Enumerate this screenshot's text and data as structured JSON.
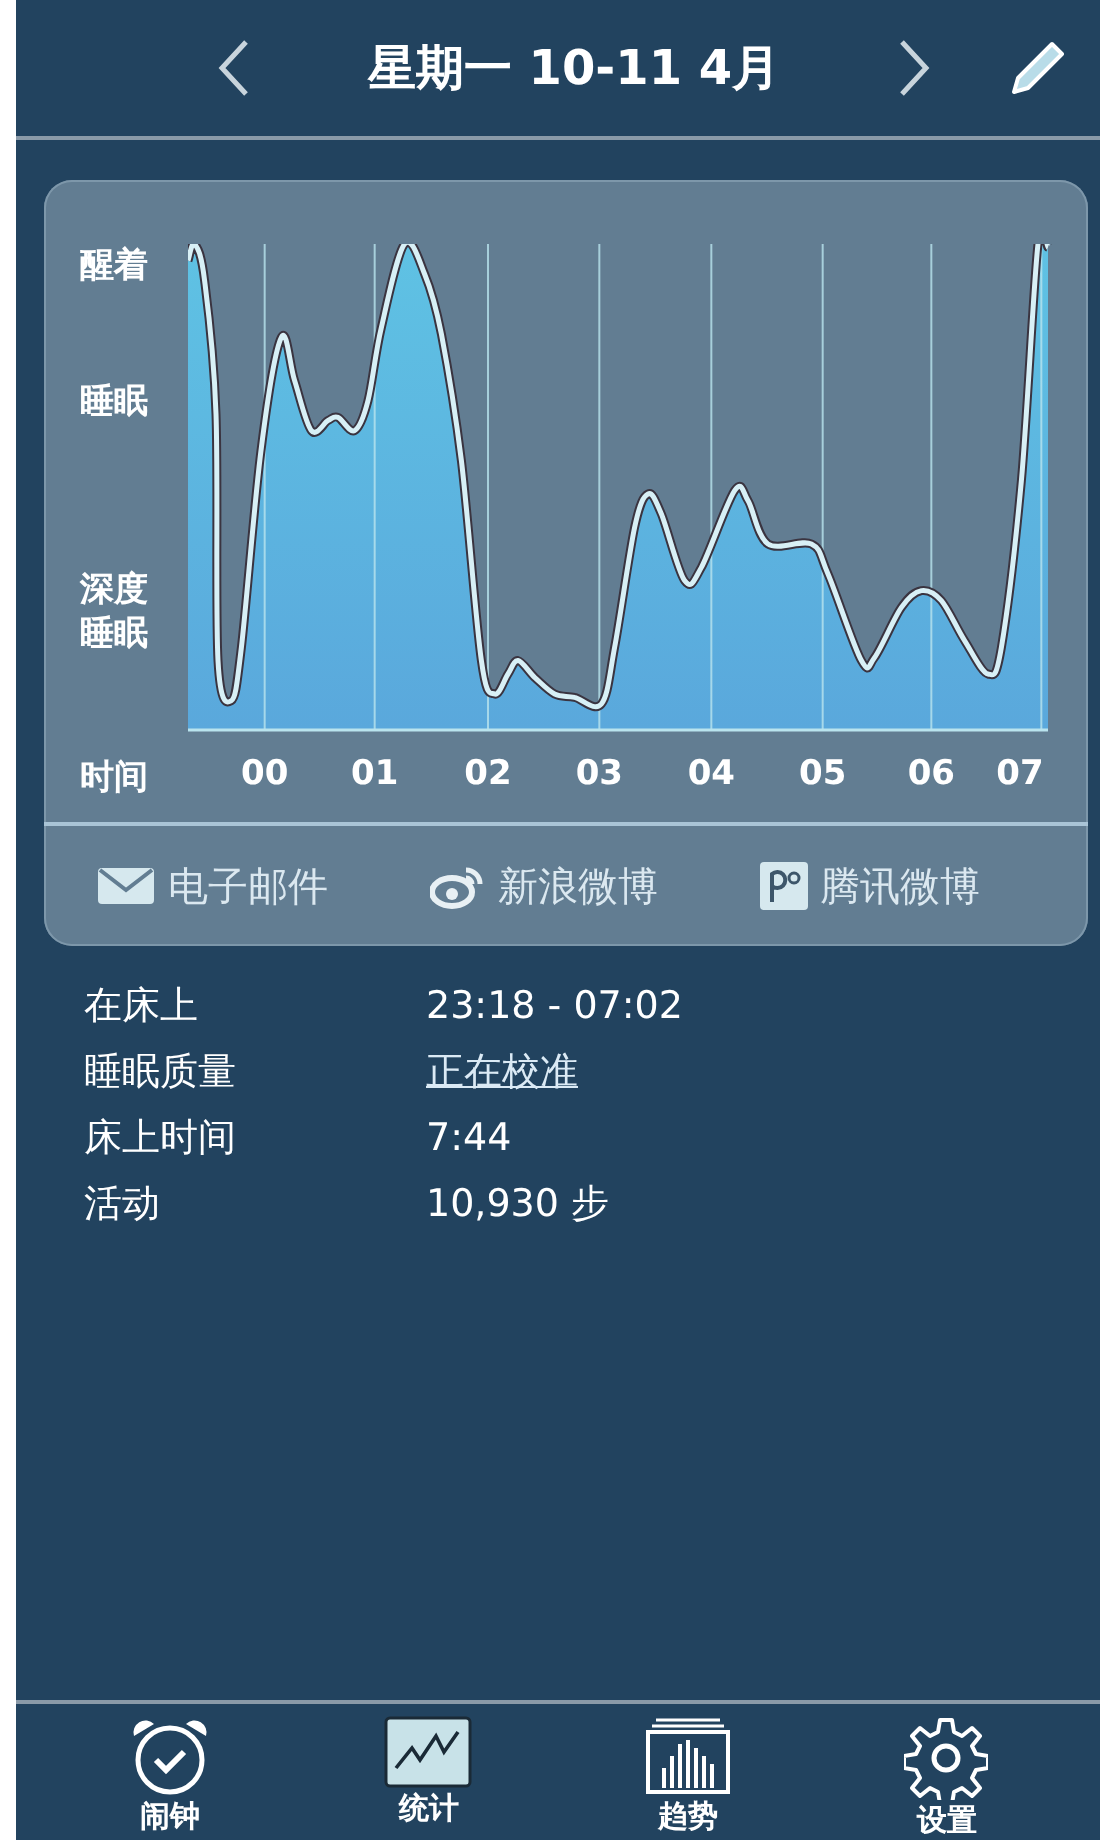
{
  "header": {
    "title": "星期一 10-11 4月"
  },
  "chart": {
    "y_labels": [
      "醒着",
      "睡眠",
      "深度睡眠"
    ],
    "x_axis_label": "时间",
    "x_labels": [
      "00",
      "01",
      "02",
      "03",
      "04",
      "05",
      "06",
      "07"
    ]
  },
  "share": [
    {
      "kind": "email",
      "label": "电子邮件"
    },
    {
      "kind": "weibo",
      "label": "新浪微博"
    },
    {
      "kind": "tencent",
      "label": "腾讯微博"
    }
  ],
  "stats": [
    {
      "label": "在床上",
      "value": "23:18 - 07:02",
      "link": false
    },
    {
      "label": "睡眠质量",
      "value": "正在校准",
      "link": true
    },
    {
      "label": "床上时间",
      "value": "7:44",
      "link": false
    },
    {
      "label": "活动",
      "value": "10,930 步",
      "link": false
    }
  ],
  "tabs": [
    {
      "kind": "alarm",
      "label": "闹钟",
      "selected": false
    },
    {
      "kind": "stats",
      "label": "统计",
      "selected": true
    },
    {
      "kind": "trends",
      "label": "趋势",
      "selected": false
    },
    {
      "kind": "settings",
      "label": "设置",
      "selected": false
    }
  ]
}
